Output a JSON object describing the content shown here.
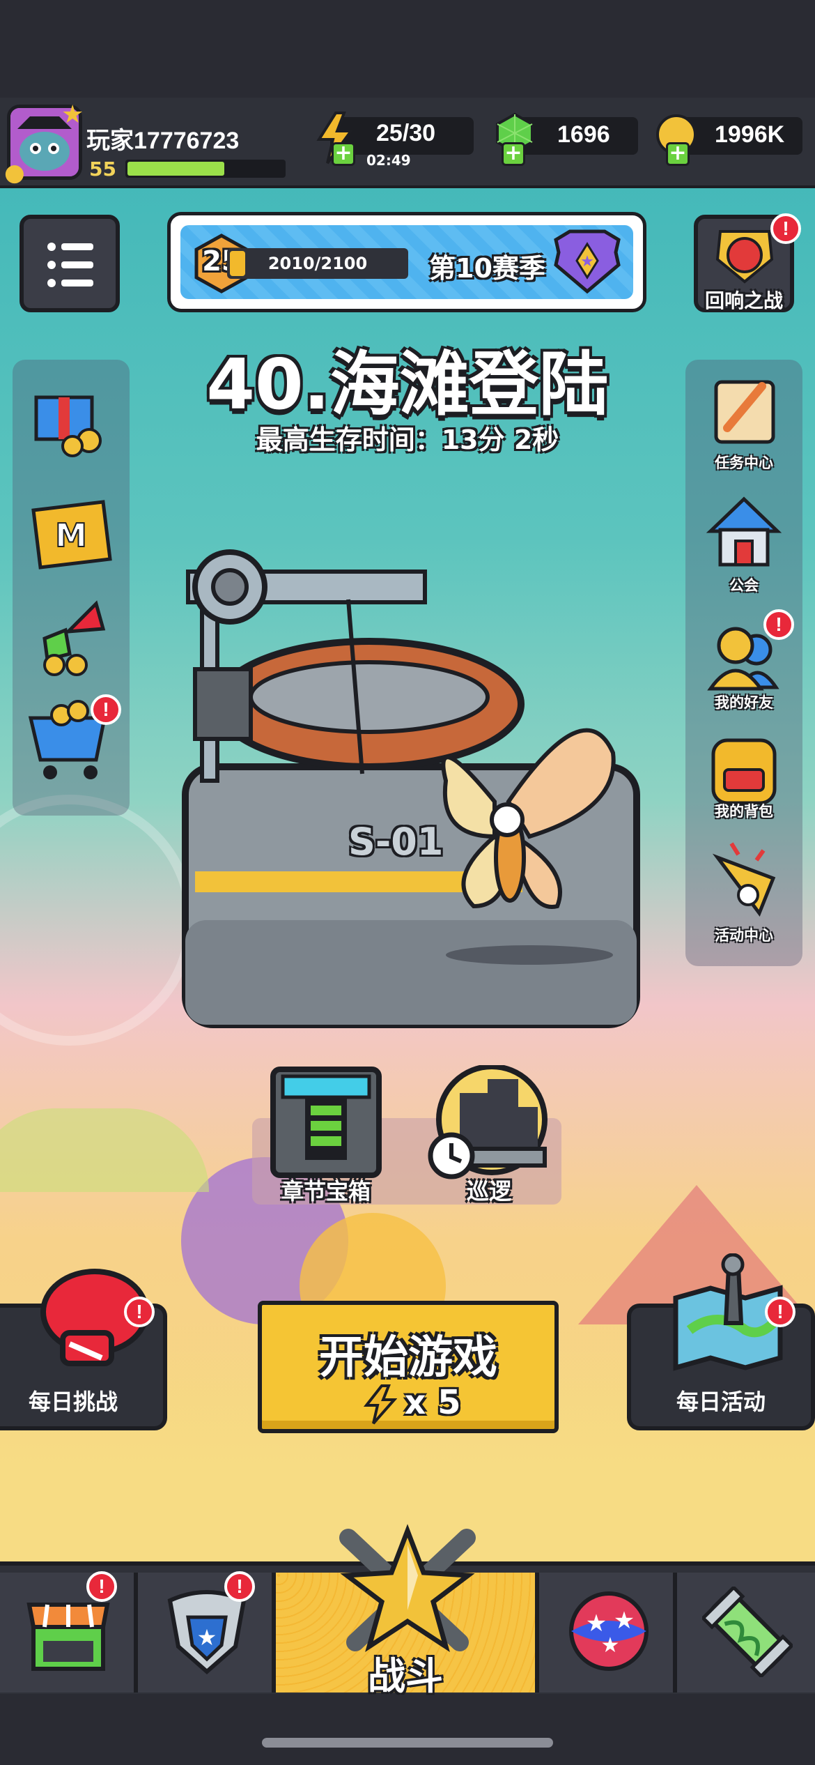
{
  "header": {
    "player_name": "玩家17776723",
    "player_level": "55",
    "xp_fraction": 0.62,
    "energy": "25/30",
    "energy_timer": "02:49",
    "gems": "1696",
    "coins": "1996K"
  },
  "season": {
    "rank": "25",
    "progress_text": "2010/2100",
    "progress_fraction": 0.957,
    "season_label": "第10赛季"
  },
  "echo_battle": {
    "label": "回响之战",
    "badge": "!"
  },
  "stage": {
    "title": "40.海滩登陆",
    "best_survival": "最高生存时间：13分 2秒",
    "platform_code": "S-01"
  },
  "left_panel": {
    "items": [
      {
        "name": "gift"
      },
      {
        "name": "m-ticket"
      },
      {
        "name": "upgrade"
      },
      {
        "name": "shop-cart",
        "badge": "!"
      }
    ]
  },
  "right_panel": {
    "items": [
      {
        "label": "任务中心"
      },
      {
        "label": "公会"
      },
      {
        "label": "我的好友",
        "badge": "!"
      },
      {
        "label": "我的背包"
      },
      {
        "label": "活动中心"
      }
    ]
  },
  "chapter_chest": {
    "label": "章节宝箱"
  },
  "patrol": {
    "label": "巡逻"
  },
  "daily_challenge": {
    "label": "每日挑战",
    "badge": "!"
  },
  "daily_event": {
    "label": "每日活动",
    "badge": "!"
  },
  "start_button": {
    "label": "开始游戏",
    "cost": "x 5"
  },
  "bottom_nav": {
    "battle_label": "战斗",
    "shop_badge": "!",
    "equip_badge": "!"
  },
  "colors": {
    "accent": "#f5c534",
    "badge": "#e8283a",
    "panel": "#2f3139",
    "xp": "#9be04a"
  }
}
